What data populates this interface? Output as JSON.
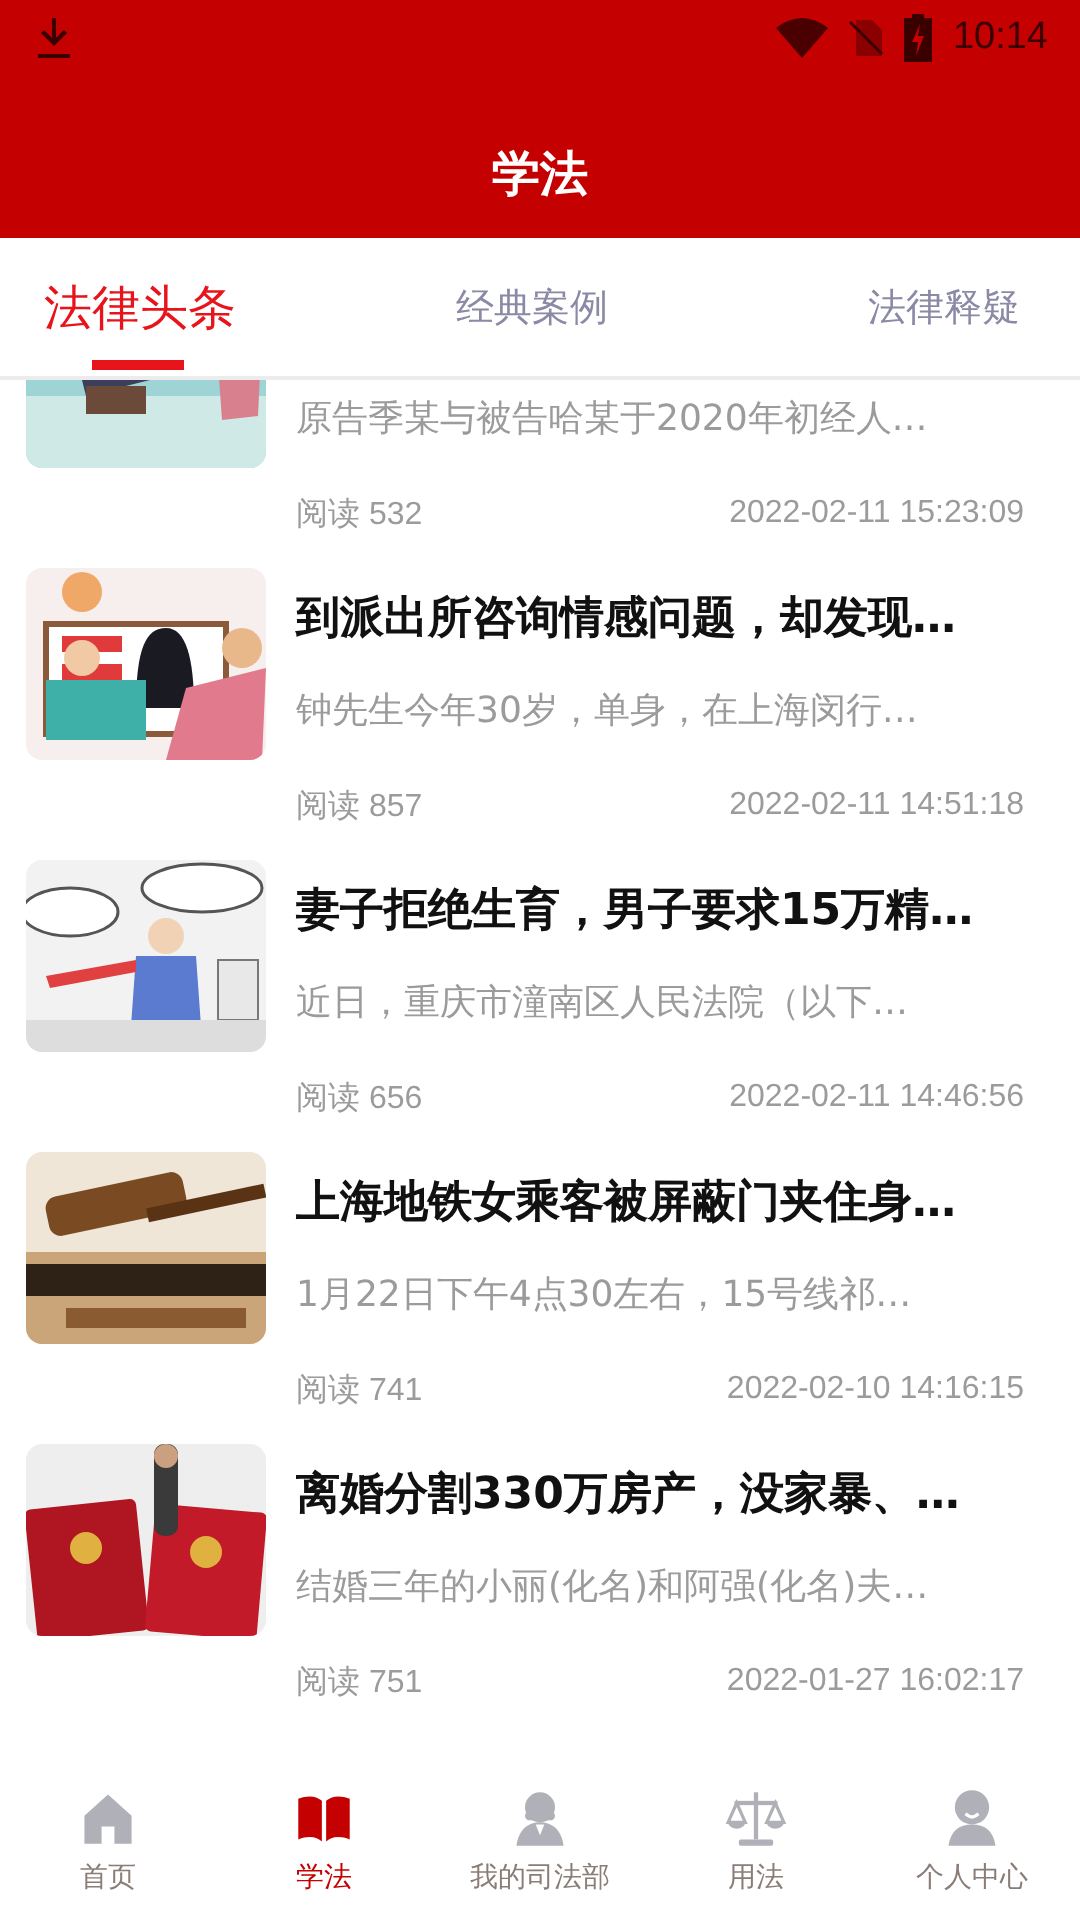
{
  "status_bar": {
    "time": "10:14"
  },
  "header": {
    "title": "学法"
  },
  "tabs": [
    {
      "label": "法律头条",
      "selected": true
    },
    {
      "label": "经典案例",
      "selected": false
    },
    {
      "label": "法律释疑",
      "selected": false
    }
  ],
  "articles": [
    {
      "summary": "原告季某与被告哈某于2020年初经人…",
      "reads": "阅读 532",
      "time": "2022-02-11 15:23:09"
    },
    {
      "title": "到派出所咨询情感问题，却发现…",
      "summary": "钟先生今年30岁，单身，在上海闵行…",
      "reads": "阅读 857",
      "time": "2022-02-11 14:51:18"
    },
    {
      "title": "妻子拒绝生育，男子要求15万精…",
      "summary": "近日，重庆市潼南区人民法院（以下…",
      "reads": "阅读 656",
      "time": "2022-02-11 14:46:56"
    },
    {
      "title": "上海地铁女乘客被屏蔽门夹住身…",
      "summary": "1月22日下午4点30左右，15号线祁…",
      "reads": "阅读 741",
      "time": "2022-02-10 14:16:15"
    },
    {
      "title": "离婚分割330万房产，没家暴、…",
      "summary": "结婚三年的小丽(化名)和阿强(化名)夫…",
      "reads": "阅读 751",
      "time": "2022-01-27 16:02:17"
    }
  ],
  "bottom_nav": [
    {
      "label": "首页",
      "selected": false
    },
    {
      "label": "学法",
      "selected": true
    },
    {
      "label": "我的司法部",
      "selected": false
    },
    {
      "label": "用法",
      "selected": false
    },
    {
      "label": "个人中心",
      "selected": false
    }
  ]
}
